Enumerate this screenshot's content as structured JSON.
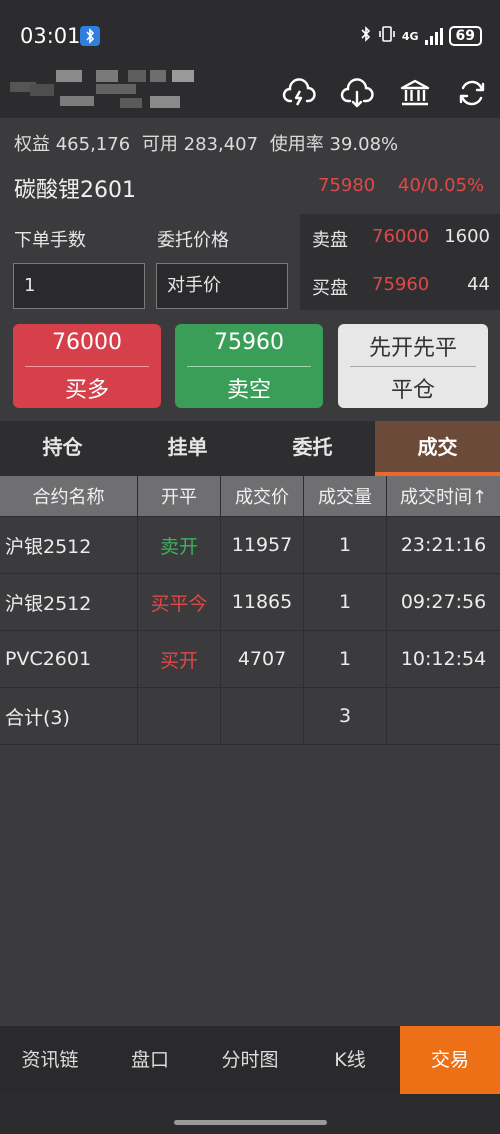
{
  "status_bar": {
    "time": "03:01",
    "network": "4G",
    "battery": "69"
  },
  "account": {
    "equity": "权益 465,176",
    "available": "可用 283,407",
    "usage": "使用率 39.08%"
  },
  "instrument": {
    "name": "碳酸锂2601",
    "last_price": "75980",
    "change": "40/0.05%"
  },
  "order_form": {
    "qty_label": "下单手数",
    "qty_value": "1",
    "price_label": "委托价格",
    "price_value": "对手价"
  },
  "order_book": [
    {
      "side": "卖盘",
      "price": "76000",
      "qty": "1600"
    },
    {
      "side": "买盘",
      "price": "75960",
      "qty": "44"
    }
  ],
  "trade_buttons": {
    "buy": {
      "price": "76000",
      "label": "买多"
    },
    "sell": {
      "price": "75960",
      "label": "卖空"
    },
    "close": {
      "mode": "先开先平",
      "label": "平仓"
    }
  },
  "tabs": [
    "持仓",
    "挂单",
    "委托",
    "成交"
  ],
  "active_tab": "成交",
  "trades_table": {
    "headers": [
      "合约名称",
      "开平",
      "成交价",
      "成交量",
      "成交时间↑"
    ],
    "rows": [
      {
        "contract": "沪银2512",
        "open_close": "卖开",
        "price": "11957",
        "volume": "1",
        "time": "23:21:16"
      },
      {
        "contract": "沪银2512",
        "open_close": "买平今",
        "price": "11865",
        "volume": "1",
        "time": "09:27:56"
      },
      {
        "contract": "PVC2601",
        "open_close": "买开",
        "price": "4707",
        "volume": "1",
        "time": "10:12:54"
      }
    ],
    "total": {
      "label": "合计(3)",
      "volume": "3"
    }
  },
  "bottom_nav": [
    "资讯链",
    "盘口",
    "分时图",
    "K线",
    "交易"
  ],
  "active_nav": "交易",
  "header_icons": [
    "cloud-upload-icon",
    "cloud-download-icon",
    "bank-icon",
    "refresh-icon"
  ],
  "colors": {
    "up_red": "#e04848",
    "down_green": "#3ab35c",
    "accent_orange": "#ee7016"
  }
}
